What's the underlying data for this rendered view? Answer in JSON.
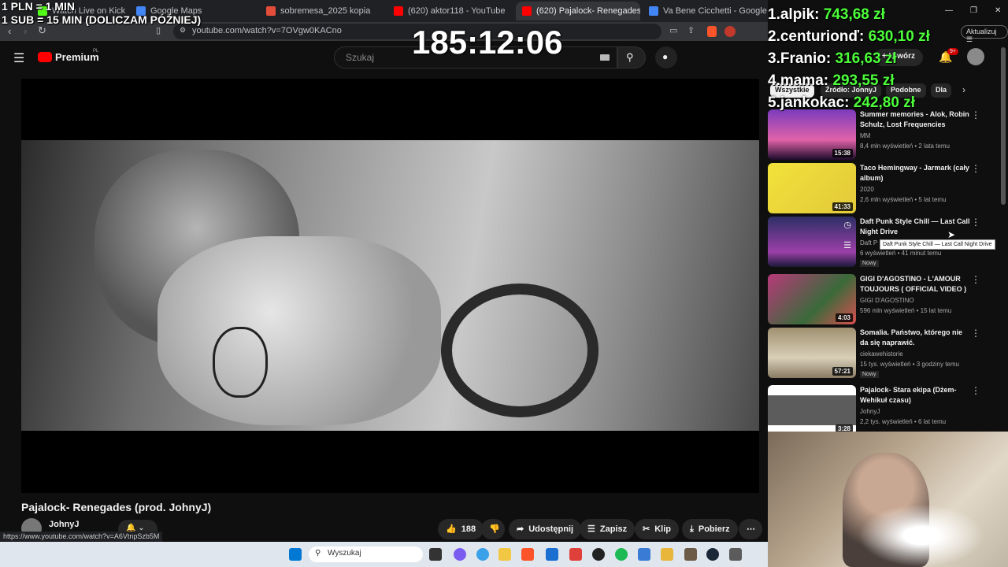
{
  "browser": {
    "tabs": [
      {
        "label": "Watch Live on Kick",
        "color": "#53fc18"
      },
      {
        "label": "Google Maps",
        "color": "#4285f4"
      },
      {
        "label": "sobremesa_2025 kopia",
        "color": "#e44d3a"
      },
      {
        "label": "(620) aktor118 - YouTube",
        "color": "#ff0000"
      },
      {
        "label": "(620) Pajalock- Renegades (p",
        "color": "#ff0000"
      },
      {
        "label": "Va Bene Cicchetti - Google Search",
        "color": "#4285f4"
      }
    ],
    "url": "youtube.com/watch?v=7OVgw0KACno",
    "update_label": "Aktualizuj",
    "status_url": "https://www.youtube.com/watch?v=A6VtnpSzb5M"
  },
  "youtube": {
    "logo_label": "Premium",
    "logo_region": "PL",
    "search_placeholder": "Szukaj",
    "create_label": "Utwórz",
    "notifications_count": "9+",
    "video_title": "Pajalock- Renegades (prod. JohnyJ)",
    "channel_name": "JohnyJ",
    "like_count": "188",
    "actions": {
      "share": "Udostępnij",
      "save": "Zapisz",
      "clip": "Klip",
      "download": "Pobierz"
    },
    "chips": [
      "Wszystkie",
      "Źródło: JohnyJ",
      "Podobne",
      "Dla"
    ],
    "recommendations": [
      {
        "title": "Summer memories - Alok, Robin Schulz, Lost Frequencies",
        "channel": "MM",
        "views": "8,4 mln wyświetleń",
        "age": "2 lata temu",
        "duration": "15:38",
        "new": "",
        "thumb": "#c55ab5"
      },
      {
        "title": "Taco Hemingway - Jarmark (cały album)",
        "channel": "2020",
        "views": "2,6 mln wyświetleń",
        "age": "5 lat temu",
        "duration": "41:33",
        "new": "",
        "thumb": "#e8d53a"
      },
      {
        "title": "Daft Punk Style Chill — Last Call Night Drive",
        "channel": "Daft P",
        "views": "6 wyświetleń",
        "age": "41 minut temu",
        "duration": "",
        "new": "Nowy",
        "thumb": "#2d2f66"
      },
      {
        "title": "GIGI D'AGOSTINO - L'AMOUR TOUJOURS ( OFFICIAL VIDEO )",
        "channel": "GIGI D'AGOSTINO",
        "views": "596 mln wyświetleń",
        "age": "15 lat temu",
        "duration": "4:03",
        "new": "",
        "thumb": "#b8397a"
      },
      {
        "title": "Somalia. Państwo, którego nie da się naprawić.",
        "channel": "ciekawehistorie",
        "views": "15 tys. wyświetleń",
        "age": "3 godziny temu",
        "duration": "57:21",
        "new": "Nowy",
        "thumb": "#8a7b63"
      },
      {
        "title": "Pajalock- Stara ekipa (Dżem- Wehikuł czasu)",
        "channel": "JohnyJ",
        "views": "2,2 tys. wyświetleń",
        "age": "6 lat temu",
        "duration": "3:28",
        "new": "",
        "thumb": "#6b6b6b"
      }
    ],
    "tooltip": "Daft Punk Style Chill — Last Call Night Drive"
  },
  "overlay": {
    "rate_line1": "1 PLN = 1 MIN",
    "rate_line2": "1 SUB = 15 MIN (DOLICZAM PÓŹNIEJ)",
    "timer": "185:12:06",
    "leaderboard": [
      {
        "name": "1.alpik:",
        "amount": "743,68 zł"
      },
      {
        "name": "2.centurionď:",
        "amount": "630,10 zł"
      },
      {
        "name": "3.Franio:",
        "amount": "316,63 zł"
      },
      {
        "name": "4.mama:",
        "amount": "293,55 zł"
      },
      {
        "name": "5.jankokac:",
        "amount": "242,80 zł"
      }
    ]
  },
  "taskbar": {
    "search_placeholder": "Wyszukaj",
    "app_icons": [
      "windows-icon",
      "task-view-icon",
      "messenger-icon",
      "copilot-icon",
      "explorer-icon",
      "brave-icon",
      "store-icon",
      "brave-red-icon",
      "obs-icon",
      "spotify-icon",
      "notepad-icon",
      "folder-icon",
      "gimp-icon",
      "steam-icon",
      "calculator-icon"
    ]
  }
}
